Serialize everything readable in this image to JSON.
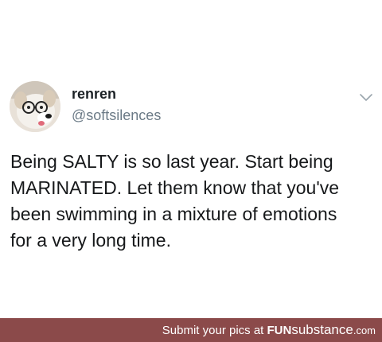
{
  "tweet": {
    "display_name": "renren",
    "handle": "@softsilences",
    "text": "Being SALTY is so last year. Start being\nMARINATED. Let them know that you've\nbeen swimming in a mixture of emotions\nfor a very long time.",
    "more_icon": "chevron-down-icon"
  },
  "footer": {
    "lead": "Submit your pics at ",
    "brand_fun": "FUN",
    "brand_sub": "substance",
    "brand_dotcom": ".com",
    "background": "#8b4a4a"
  },
  "colors": {
    "name": "#1c2226",
    "handle": "#6b7a86",
    "text": "#16181a"
  }
}
